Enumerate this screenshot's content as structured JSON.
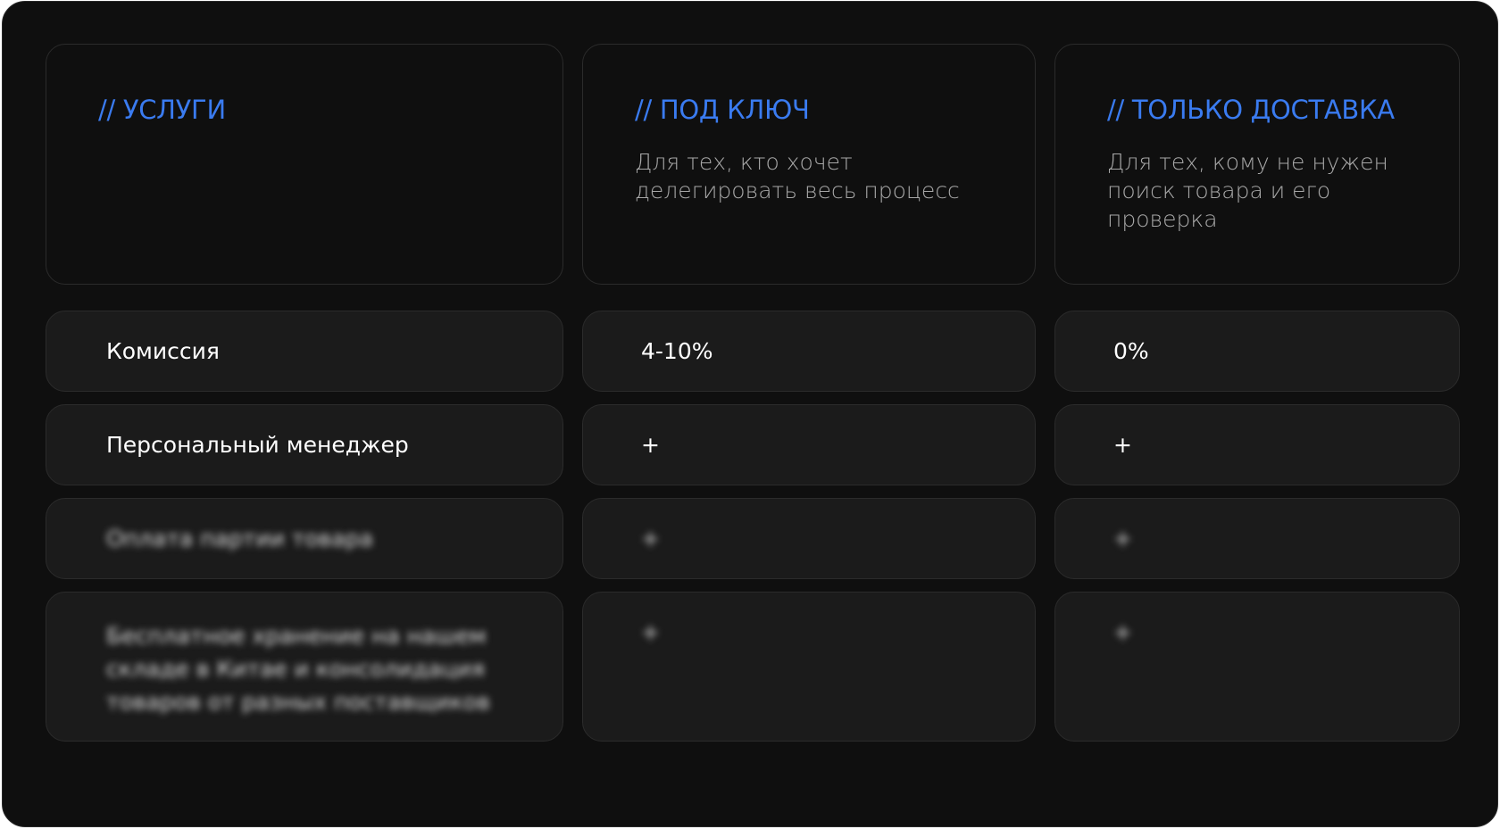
{
  "columns": {
    "services": {
      "title": "// УСЛУГИ"
    },
    "turnkey": {
      "title": "// ПОД КЛЮЧ",
      "description": "Для тех, кто хочет\nделегировать весь процесс"
    },
    "delivery_only": {
      "title": "// ТОЛЬКО ДОСТАВКА",
      "description": "Для тех, кому не нужен\nпоиск товара и его\nпроверка"
    }
  },
  "rows": [
    {
      "label": "Комиссия",
      "turnkey": "4-10%",
      "delivery_only": "0%"
    },
    {
      "label": "Персональный менеджер",
      "turnkey": "+",
      "delivery_only": "+"
    },
    {
      "label": "Оплата партии товара",
      "turnkey": "+",
      "delivery_only": "+",
      "blurred": true
    },
    {
      "label": "Бесплатное хранение на нашем\nскладе в Китае и консолидация\nтоваров от разных поставщиков",
      "turnkey": "+",
      "delivery_only": "+",
      "blurred": true
    }
  ],
  "colors": {
    "accent": "#3a7bf0",
    "background": "#0f0f0f",
    "card": "#1b1b1b"
  }
}
